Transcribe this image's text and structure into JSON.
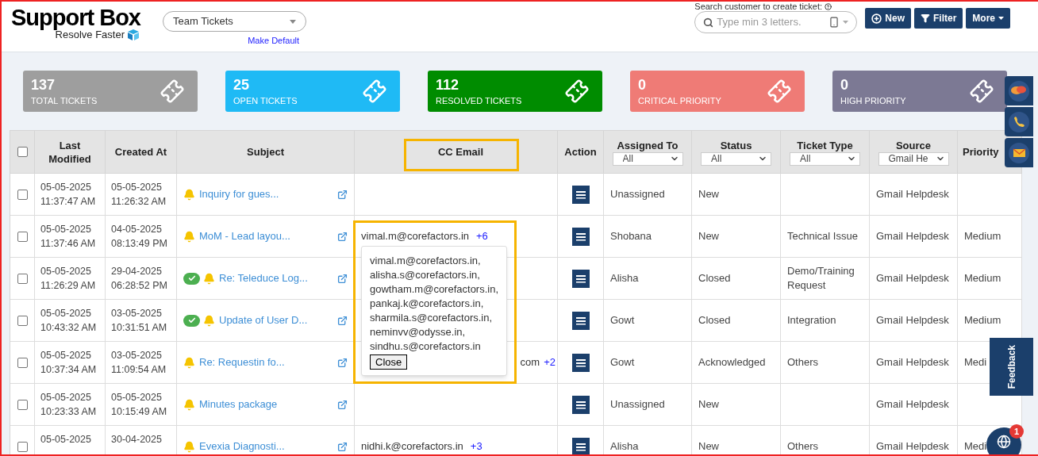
{
  "header": {
    "logo_title": "Support Box",
    "logo_tagline": "Resolve Faster",
    "view_select": "Team Tickets",
    "make_default": "Make Default",
    "search_label": "Search customer to create ticket:",
    "search_placeholder": "Type min 3 letters.",
    "buttons": [
      {
        "label": "New",
        "kind": "new"
      },
      {
        "label": "Filter",
        "kind": "filter"
      },
      {
        "label": "More",
        "kind": "more"
      }
    ]
  },
  "stats": [
    {
      "value": "137",
      "label": "TOTAL TICKETS",
      "color": "#9e9e9e"
    },
    {
      "value": "25",
      "label": "OPEN TICKETS",
      "color": "#1fbaf5"
    },
    {
      "value": "112",
      "label": "RESOLVED TICKETS",
      "color": "#008c00"
    },
    {
      "value": "0",
      "label": "CRITICAL PRIORITY",
      "color": "#ef7b76"
    },
    {
      "value": "0",
      "label": "HIGH PRIORITY",
      "color": "#7c7994"
    }
  ],
  "table": {
    "select_all": {
      "checked": false
    },
    "columns": [
      {
        "label": "Last Modified"
      },
      {
        "label": "Created At"
      },
      {
        "label": "Subject"
      },
      {
        "label": "CC Email",
        "highlighted": true
      },
      {
        "label": "Action"
      },
      {
        "label": "Assigned To",
        "filter": "All"
      },
      {
        "label": "Status",
        "filter": "All"
      },
      {
        "label": "Ticket Type",
        "filter": "All"
      },
      {
        "label": "Source",
        "filter": "Gmail He"
      },
      {
        "label": "Priority"
      }
    ],
    "rows": [
      {
        "checked": false,
        "last_modified": [
          "05-05-2025",
          "11:37:47 AM"
        ],
        "created_at": [
          "05-05-2025",
          "11:26:32 AM"
        ],
        "subject": "Inquiry for gues...",
        "resolved": false,
        "assigned_to": "Unassigned",
        "status": "New",
        "source": "Gmail Helpdesk"
      },
      {
        "checked": false,
        "last_modified": [
          "05-05-2025",
          "11:37:46 AM"
        ],
        "created_at": [
          "04-05-2025",
          "08:13:49 PM"
        ],
        "subject": "MoM - Lead layou...",
        "resolved": false,
        "cc": {
          "email": "vimal.m@corefactors.in",
          "more": "+6",
          "covered": false
        },
        "assigned_to": "Shobana",
        "status": "New",
        "ticket_type": "Technical Issue",
        "source": "Gmail Helpdesk",
        "priority": "Medium"
      },
      {
        "checked": false,
        "last_modified": [
          "05-05-2025",
          "11:26:29 AM"
        ],
        "created_at": [
          "29-04-2025",
          "06:28:52 PM"
        ],
        "subject": "Re: Teleduce Log...",
        "resolved": true,
        "assigned_to": "Alisha",
        "status": "Closed",
        "ticket_type": "Demo/Training Request",
        "source": "Gmail Helpdesk",
        "priority": "Medium"
      },
      {
        "checked": false,
        "last_modified": [
          "05-05-2025",
          "10:43:32 AM"
        ],
        "created_at": [
          "03-05-2025",
          "10:31:51 AM"
        ],
        "subject": "Update of User D...",
        "resolved": true,
        "assigned_to": "Gowt",
        "status": "Closed",
        "ticket_type": "Integration",
        "source": "Gmail Helpdesk",
        "priority": "Medium"
      },
      {
        "checked": false,
        "last_modified": [
          "05-05-2025",
          "10:37:34 AM"
        ],
        "created_at": [
          "03-05-2025",
          "11:09:54 AM"
        ],
        "subject": "Re: Requestin fo...",
        "resolved": false,
        "cc": {
          "email": "com",
          "more": "+2",
          "covered": true
        },
        "assigned_to": "Gowt",
        "status": "Acknowledged",
        "ticket_type": "Others",
        "source": "Gmail Helpdesk",
        "priority": "Medi"
      },
      {
        "checked": false,
        "last_modified": [
          "05-05-2025",
          "10:23:33 AM"
        ],
        "created_at": [
          "05-05-2025",
          "10:15:49 AM"
        ],
        "subject": "Minutes package",
        "resolved": false,
        "assigned_to": "Unassigned",
        "status": "New",
        "source": "Gmail Helpdesk"
      },
      {
        "checked": false,
        "last_modified": [
          "05-05-2025"
        ],
        "created_at": [
          "30-04-2025"
        ],
        "subject": "Evexia Diagnosti...",
        "resolved": false,
        "cc": {
          "email": "nidhi.k@corefactors.in",
          "more": "+3",
          "covered": false
        },
        "assigned_to": "Alisha",
        "status": "New",
        "ticket_type": "Others",
        "source": "Gmail Helpdesk",
        "priority": "Medi"
      }
    ]
  },
  "cc_popup": {
    "emails": [
      "vimal.m@corefactors.in,",
      "alisha.s@corefactors.in,",
      "gowtham.m@corefactors.in,",
      "pankaj.k@corefactors.in,",
      "sharmila.s@corefactors.in,",
      "neminvv@odysse.in,",
      "sindhu.s@corefactors.in"
    ],
    "close": "Close"
  },
  "feedback": "Feedback",
  "chat_badge": "1"
}
